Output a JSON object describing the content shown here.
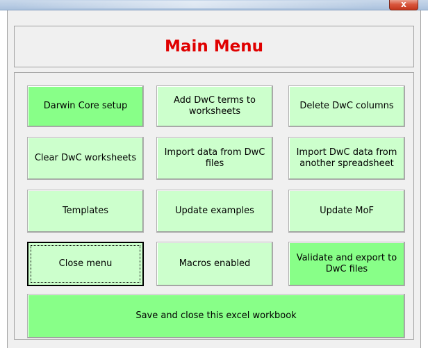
{
  "window": {
    "close_glyph": "x"
  },
  "header": {
    "title": "Main Menu",
    "title_color": "#e00000"
  },
  "colors": {
    "button_light": "#ccffcc",
    "button_green": "#88ff88",
    "panel_background": "#f0f0f0"
  },
  "buttons": {
    "darwin_core_setup": "Darwin Core setup",
    "add_dwc_terms": "Add DwC terms to worksheets",
    "delete_dwc_columns": "Delete DwC columns",
    "clear_dwc_worksheets": "Clear DwC worksheets",
    "import_from_dwc_files": "Import data from DwC files",
    "import_from_spreadsheet": "Import DwC data from another spreadsheet",
    "templates": "Templates",
    "update_examples": "Update examples",
    "update_mof": "Update MoF",
    "close_menu": "Close menu",
    "macros_enabled": "Macros enabled",
    "validate_export": "Validate and export to DwC files",
    "save_close": "Save and close this excel workbook"
  }
}
